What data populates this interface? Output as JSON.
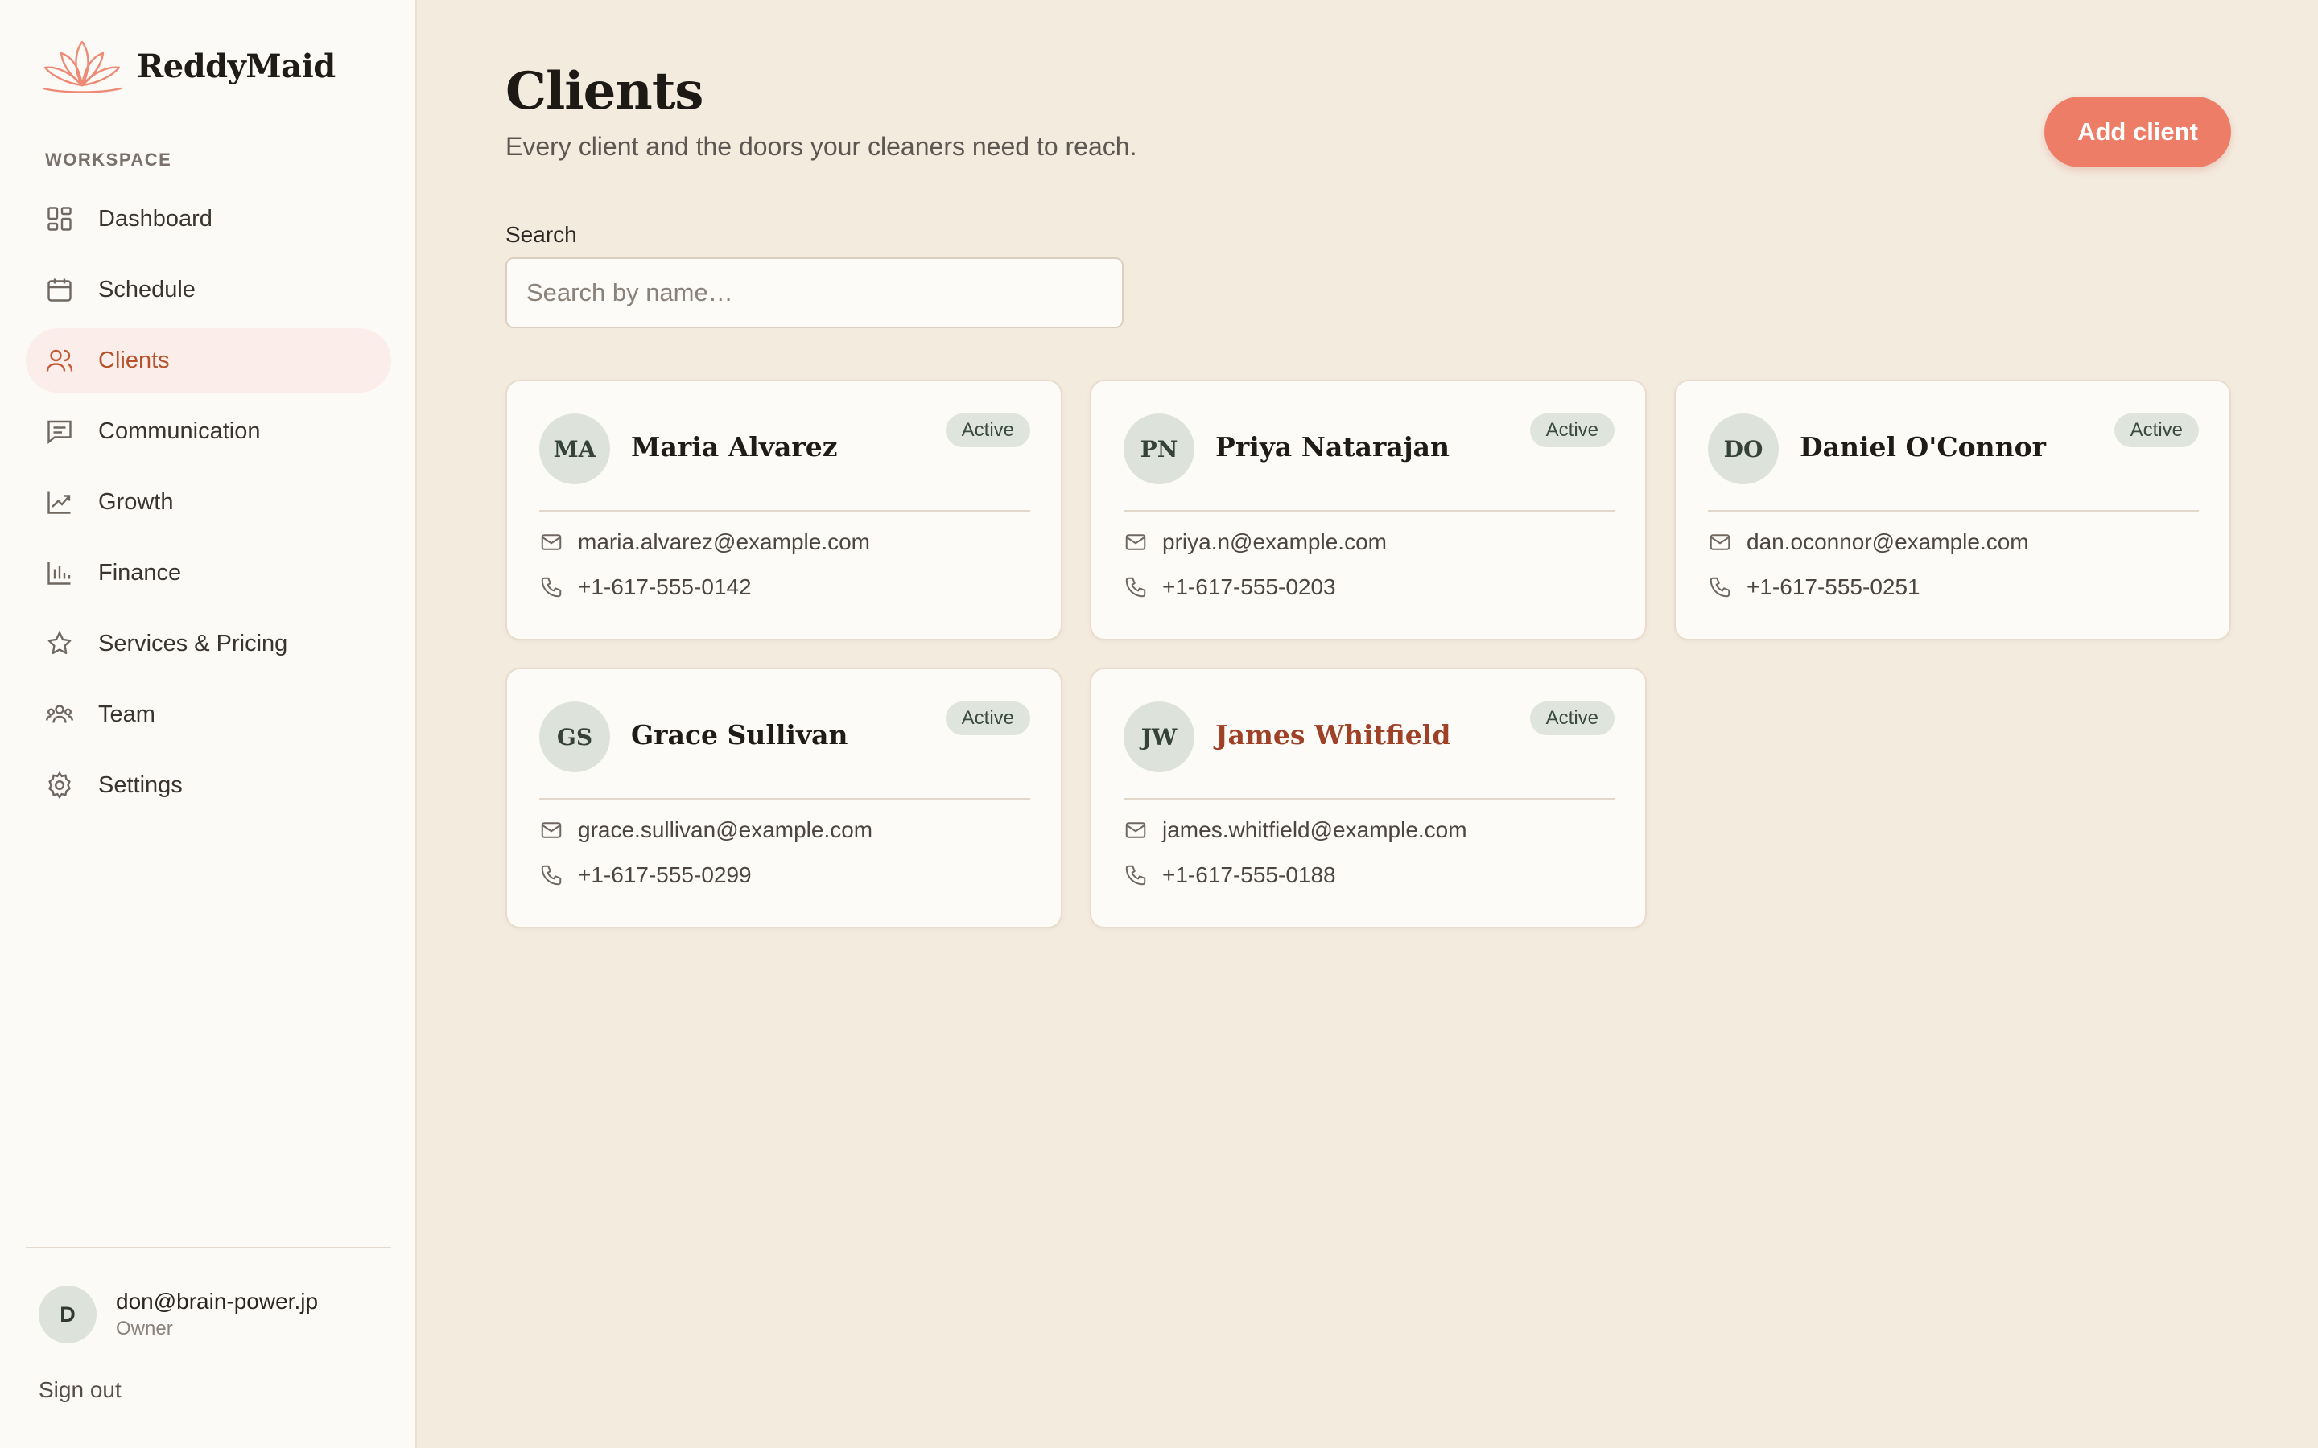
{
  "brand": {
    "name": "ReddyMaid",
    "logo_icon": "lotus-icon",
    "logo_color": "#ee8a75"
  },
  "sidebar": {
    "section_label": "WORKSPACE",
    "items": [
      {
        "label": "Dashboard",
        "icon": "dashboard-icon",
        "active": false
      },
      {
        "label": "Schedule",
        "icon": "calendar-icon",
        "active": false
      },
      {
        "label": "Clients",
        "icon": "users-icon",
        "active": true
      },
      {
        "label": "Communication",
        "icon": "message-icon",
        "active": false
      },
      {
        "label": "Growth",
        "icon": "trend-icon",
        "active": false
      },
      {
        "label": "Finance",
        "icon": "bar-chart-icon",
        "active": false
      },
      {
        "label": "Services & Pricing",
        "icon": "star-icon",
        "active": false
      },
      {
        "label": "Team",
        "icon": "team-icon",
        "active": false
      },
      {
        "label": "Settings",
        "icon": "gear-icon",
        "active": false
      }
    ],
    "user": {
      "initial": "D",
      "email": "don@brain-power.jp",
      "role": "Owner"
    },
    "sign_out": "Sign out"
  },
  "header": {
    "title": "Clients",
    "subtitle": "Every client and the doors your cleaners need to reach.",
    "add_button": "Add client"
  },
  "search": {
    "label": "Search",
    "placeholder": "Search by name…",
    "value": ""
  },
  "clients": [
    {
      "initials": "MA",
      "name": "Maria Alvarez",
      "status": "Active",
      "email": "maria.alvarez@example.com",
      "phone": "+1-617-555-0142"
    },
    {
      "initials": "PN",
      "name": "Priya Natarajan",
      "status": "Active",
      "email": "priya.n@example.com",
      "phone": "+1-617-555-0203"
    },
    {
      "initials": "DO",
      "name": "Daniel O'Connor",
      "status": "Active",
      "email": "dan.oconnor@example.com",
      "phone": "+1-617-555-0251"
    },
    {
      "initials": "GS",
      "name": "Grace Sullivan",
      "status": "Active",
      "email": "grace.sullivan@example.com",
      "phone": "+1-617-555-0299"
    },
    {
      "initials": "JW",
      "name": "James Whitfield",
      "status": "Active",
      "email": "james.whitfield@example.com",
      "phone": "+1-617-555-0188"
    }
  ],
  "colors": {
    "accent": "#ee7d67",
    "active_nav_text": "#b5532c",
    "background": "#f4ebdf",
    "sidebar": "#fcfaf6",
    "badge": "#dfe4dc"
  }
}
